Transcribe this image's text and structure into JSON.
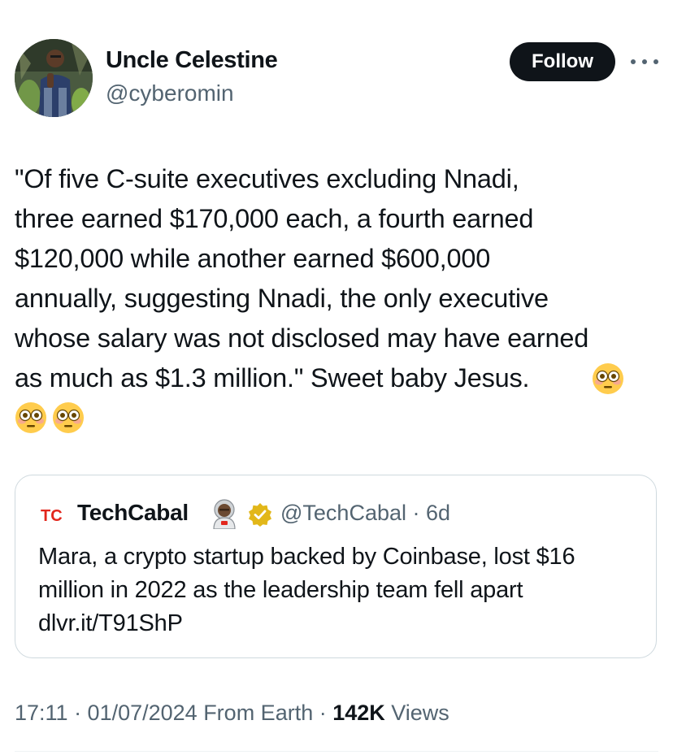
{
  "author": {
    "name": "Uncle Celestine",
    "handle": "@cyberomin"
  },
  "follow_label": "Follow",
  "tweet": {
    "text": "\"Of five C-suite executives excluding Nnadi,\nthree earned $170,000 each, a fourth earned\n$120,000 while another earned $600,000\nannually, suggesting Nnadi, the only executive\nwhose salary was not disclosed may have earned\nas much as $1.3 million.\" Sweet baby Jesus.",
    "emojis": [
      "flushed-face",
      "flushed-face",
      "flushed-face"
    ]
  },
  "quote": {
    "logo_text": "TC",
    "name": "TechCabal",
    "handle_time": "@TechCabal · 6d",
    "text": "Mara, a crypto startup backed by Coinbase, lost $16 million in 2022 as the leadership team fell apart dlvr.it/T91ShP"
  },
  "meta": {
    "time_date": "17:11 · 01/07/2024 From Earth · ",
    "views_count": "142K",
    "views_label": " Views"
  },
  "colors": {
    "text": "#0f1419",
    "secondary": "#536471",
    "border": "#cfd9de",
    "verified_gold": "#e2b719",
    "logo_red": "#e2261c"
  }
}
